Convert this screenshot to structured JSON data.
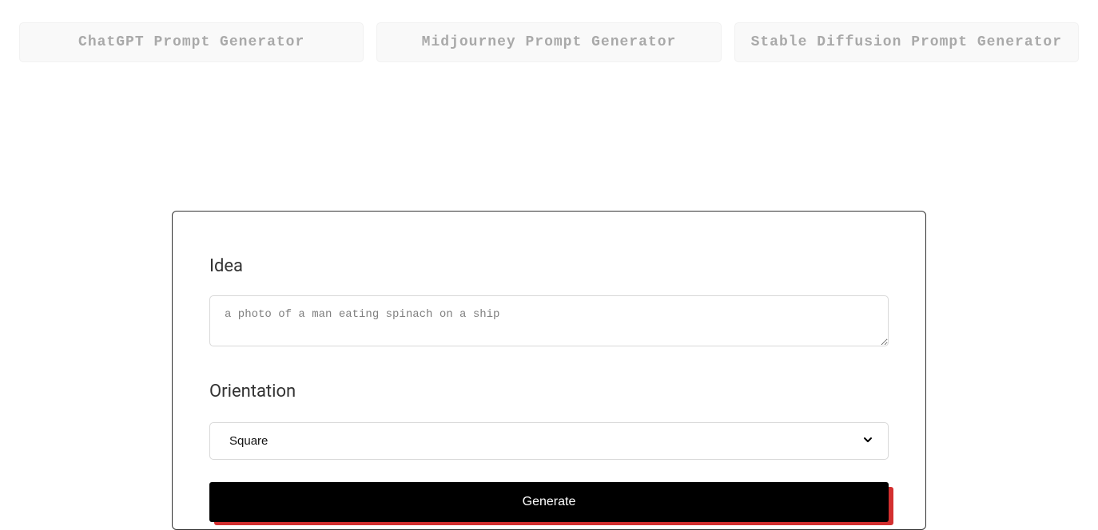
{
  "tabs": [
    {
      "label": "ChatGPT Prompt Generator"
    },
    {
      "label": "Midjourney Prompt Generator"
    },
    {
      "label": "Stable Diffusion Prompt Generator"
    }
  ],
  "form": {
    "idea_label": "Idea",
    "idea_value": "a photo of a man eating spinach on a ship",
    "orientation_label": "Orientation",
    "orientation_selected": "Square",
    "generate_label": "Generate"
  }
}
